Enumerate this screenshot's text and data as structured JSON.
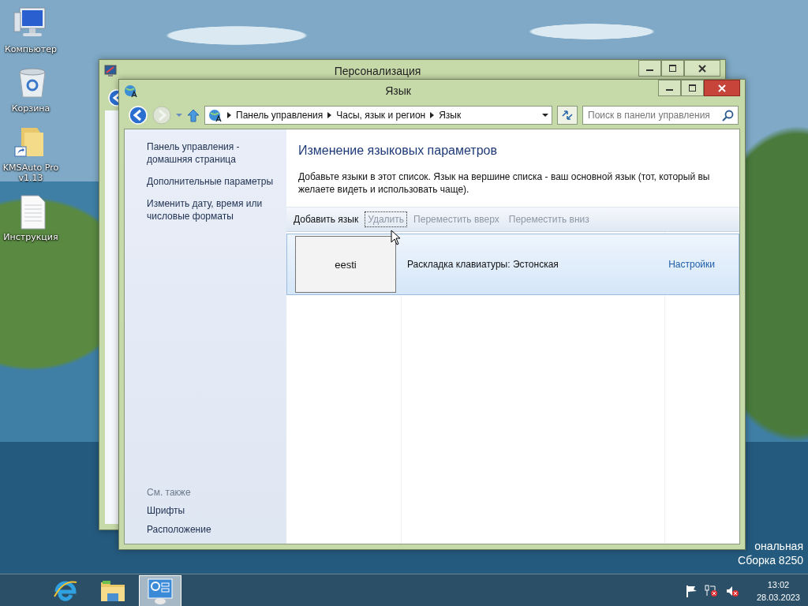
{
  "desktop_icons": [
    {
      "label": "Компьютер",
      "kind": "computer"
    },
    {
      "label": "Корзина",
      "kind": "bin"
    },
    {
      "label": "KMSAuto Pro v1.13",
      "kind": "folder-shortcut"
    },
    {
      "label": "Инструкция",
      "kind": "document"
    }
  ],
  "background_window": {
    "title": "Персонализация"
  },
  "window": {
    "title": "Язык",
    "address_path": [
      "Панель управления",
      "Часы, язык и регион",
      "Язык"
    ],
    "search": {
      "placeholder": "Поиск в панели управления"
    },
    "sidebar": {
      "links": [
        "Панель управления - домашняя страница",
        "Дополнительные параметры",
        "Изменить дату, время или числовые форматы"
      ],
      "see_also_heading": "См. также",
      "see_also": [
        "Шрифты",
        "Расположение"
      ]
    },
    "heading": "Изменение языковых параметров",
    "description": "Добавьте языки в этот список. Язык на вершине списка - ваш основной язык (тот, который вы желаете видеть и использовать чаще).",
    "toolbar": [
      {
        "label": "Добавить язык",
        "disabled": false,
        "focused": false
      },
      {
        "label": "Удалить",
        "disabled": true,
        "focused": true
      },
      {
        "label": "Переместить вверх",
        "disabled": true,
        "focused": false
      },
      {
        "label": "Переместить вниз",
        "disabled": true,
        "focused": false
      }
    ],
    "languages": [
      {
        "name": "eesti",
        "details": "Раскладка клавиатуры: Эстонская",
        "options_link": "Настройки",
        "selected": true
      }
    ]
  },
  "desktop_info": [
    "ональная",
    "Сборка 8250"
  ],
  "taskbar": {
    "apps": [
      {
        "kind": "browser",
        "selected": false
      },
      {
        "kind": "explorer",
        "selected": false
      },
      {
        "kind": "control-panel",
        "selected": true
      }
    ],
    "tray": {
      "time": "13:02",
      "date": "28.03.2023"
    }
  }
}
